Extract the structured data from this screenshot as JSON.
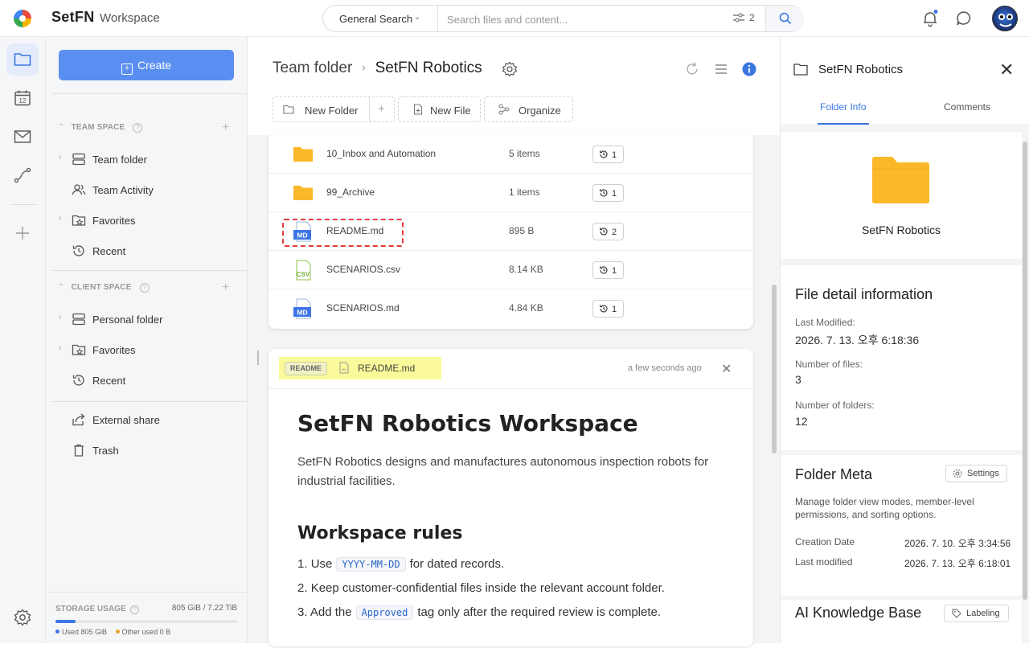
{
  "app": {
    "brand": "SetFN",
    "workspace": "Workspace"
  },
  "search": {
    "scope": "General Search",
    "placeholder": "Search files and content...",
    "filter_count": "2"
  },
  "rail": {
    "items": [
      "folder-icon",
      "calendar-icon",
      "mail-icon",
      "workflow-icon",
      "plus-icon",
      "settings-icon"
    ],
    "calendar_day": "12"
  },
  "sidebar": {
    "create_label": "Create",
    "team_space": {
      "title": "TEAM SPACE",
      "items": [
        {
          "label": "Team folder",
          "icon": "drive-icon",
          "expandable": true
        },
        {
          "label": "Team Activity",
          "icon": "people-icon",
          "expandable": false
        },
        {
          "label": "Favorites",
          "icon": "star-folder-icon",
          "expandable": true
        },
        {
          "label": "Recent",
          "icon": "history-icon",
          "expandable": false
        }
      ]
    },
    "client_space": {
      "title": "CLIENT SPACE",
      "items": [
        {
          "label": "Personal folder",
          "icon": "drive-icon",
          "expandable": true
        },
        {
          "label": "Favorites",
          "icon": "star-folder-icon",
          "expandable": true
        },
        {
          "label": "Recent",
          "icon": "history-icon",
          "expandable": false
        }
      ]
    },
    "other": [
      {
        "label": "External share",
        "icon": "share-icon"
      },
      {
        "label": "Trash",
        "icon": "trash-icon"
      }
    ],
    "storage": {
      "title": "STORAGE USAGE",
      "summary": "805 GiB / 7.22 TiB",
      "used_fraction": 0.11,
      "used_label": "Used 805 GiB",
      "other_label": "Other used 0 B",
      "used_color": "#3d74e6",
      "other_color": "#f0a030"
    }
  },
  "main": {
    "breadcrumb": {
      "parent": "Team folder",
      "current": "SetFN Robotics"
    },
    "toolbar": {
      "new_folder": "New Folder",
      "new_file": "New File",
      "organize": "Organize"
    },
    "files": [
      {
        "name": "10_Inbox and Automation",
        "type": "folder",
        "size": "5 items",
        "versions": "1"
      },
      {
        "name": "99_Archive",
        "type": "folder",
        "size": "1 items",
        "versions": "1"
      },
      {
        "name": "README.md",
        "type": "md",
        "size": "895 B",
        "versions": "2"
      },
      {
        "name": "SCENARIOS.csv",
        "type": "csv",
        "size": "8.14 KB",
        "versions": "1"
      },
      {
        "name": "SCENARIOS.md",
        "type": "md",
        "size": "4.84 KB",
        "versions": "1"
      }
    ],
    "readme": {
      "chip": "README",
      "filename": "README.md",
      "updated": "a few seconds ago",
      "title": "SetFN Robotics Workspace",
      "intro": "SetFN Robotics designs and manufactures autonomous inspection robots for industrial facilities.",
      "rules_title": "Workspace rules",
      "rules": [
        {
          "num": "1.",
          "before": "Use",
          "code": "YYYY-MM-DD",
          "after": "for dated records."
        },
        {
          "num": "2.",
          "before": "Keep customer-confidential files inside the relevant account folder.",
          "code": "",
          "after": ""
        },
        {
          "num": "3.",
          "before": "Add the",
          "code": "Approved",
          "after": "tag only after the required review is complete."
        }
      ]
    }
  },
  "panel": {
    "title": "SetFN Robotics",
    "tabs": [
      "Folder Info",
      "Comments"
    ],
    "folder_name": "SetFN Robotics",
    "detail": {
      "title": "File detail information",
      "last_modified_label": "Last Modified:",
      "last_modified": "2026. 7. 13. 오후 6:18:36",
      "files_label": "Number of files:",
      "files": "3",
      "folders_label": "Number of folders:",
      "folders": "12"
    },
    "meta": {
      "title": "Folder Meta",
      "settings_label": "Settings",
      "description": "Manage folder view modes, member-level permissions, and sorting options.",
      "creation_label": "Creation Date",
      "creation": "2026. 7. 10. 오후 3:34:56",
      "modified_label": "Last modified",
      "modified": "2026. 7. 13. 오후 6:18:01"
    },
    "ai": {
      "title": "AI Knowledge Base",
      "labeling_label": "Labeling"
    }
  }
}
